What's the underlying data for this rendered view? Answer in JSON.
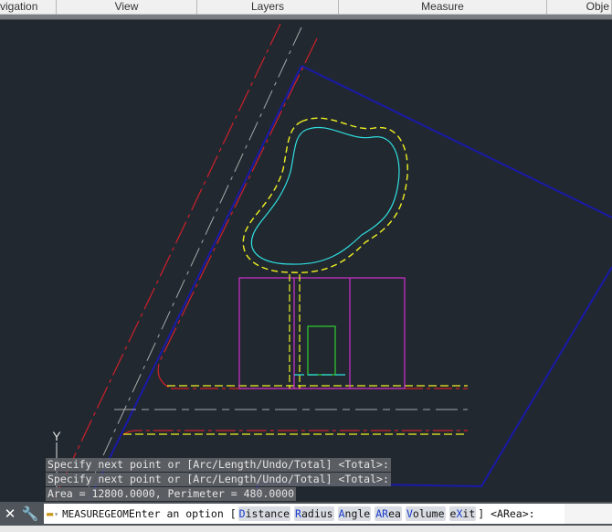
{
  "ribbon": {
    "panels": [
      "vigation",
      "View",
      "Layers",
      "Measure",
      "Obje"
    ]
  },
  "ucs": {
    "y_label": "Y"
  },
  "history": [
    "Specify next point or [Arc/Length/Undo/Total] <Total>:",
    "Specify next point or [Arc/Length/Undo/Total] <Total>:",
    "Area = 12800.0000, Perimeter = 480.0000"
  ],
  "command": {
    "name": "MEASUREGEOM",
    "prompt": "Enter an option [",
    "options": [
      {
        "key": "D",
        "rest": "istance"
      },
      {
        "key": "R",
        "rest": "adius"
      },
      {
        "key": "A",
        "rest": "ngle"
      },
      {
        "key": "AR",
        "rest": "ea"
      },
      {
        "key": "V",
        "rest": "olume"
      },
      {
        "pre": "e",
        "key": "X",
        "rest": "it"
      }
    ],
    "suffix": "] <ARea>:"
  },
  "colors": {
    "background": "#212830",
    "boundary": "#1a1aa8",
    "road_red": "#d0202a",
    "road_yellow": "#f0f020",
    "building": "#d030d0",
    "pond": "#30e0e0",
    "green": "#30d030"
  }
}
